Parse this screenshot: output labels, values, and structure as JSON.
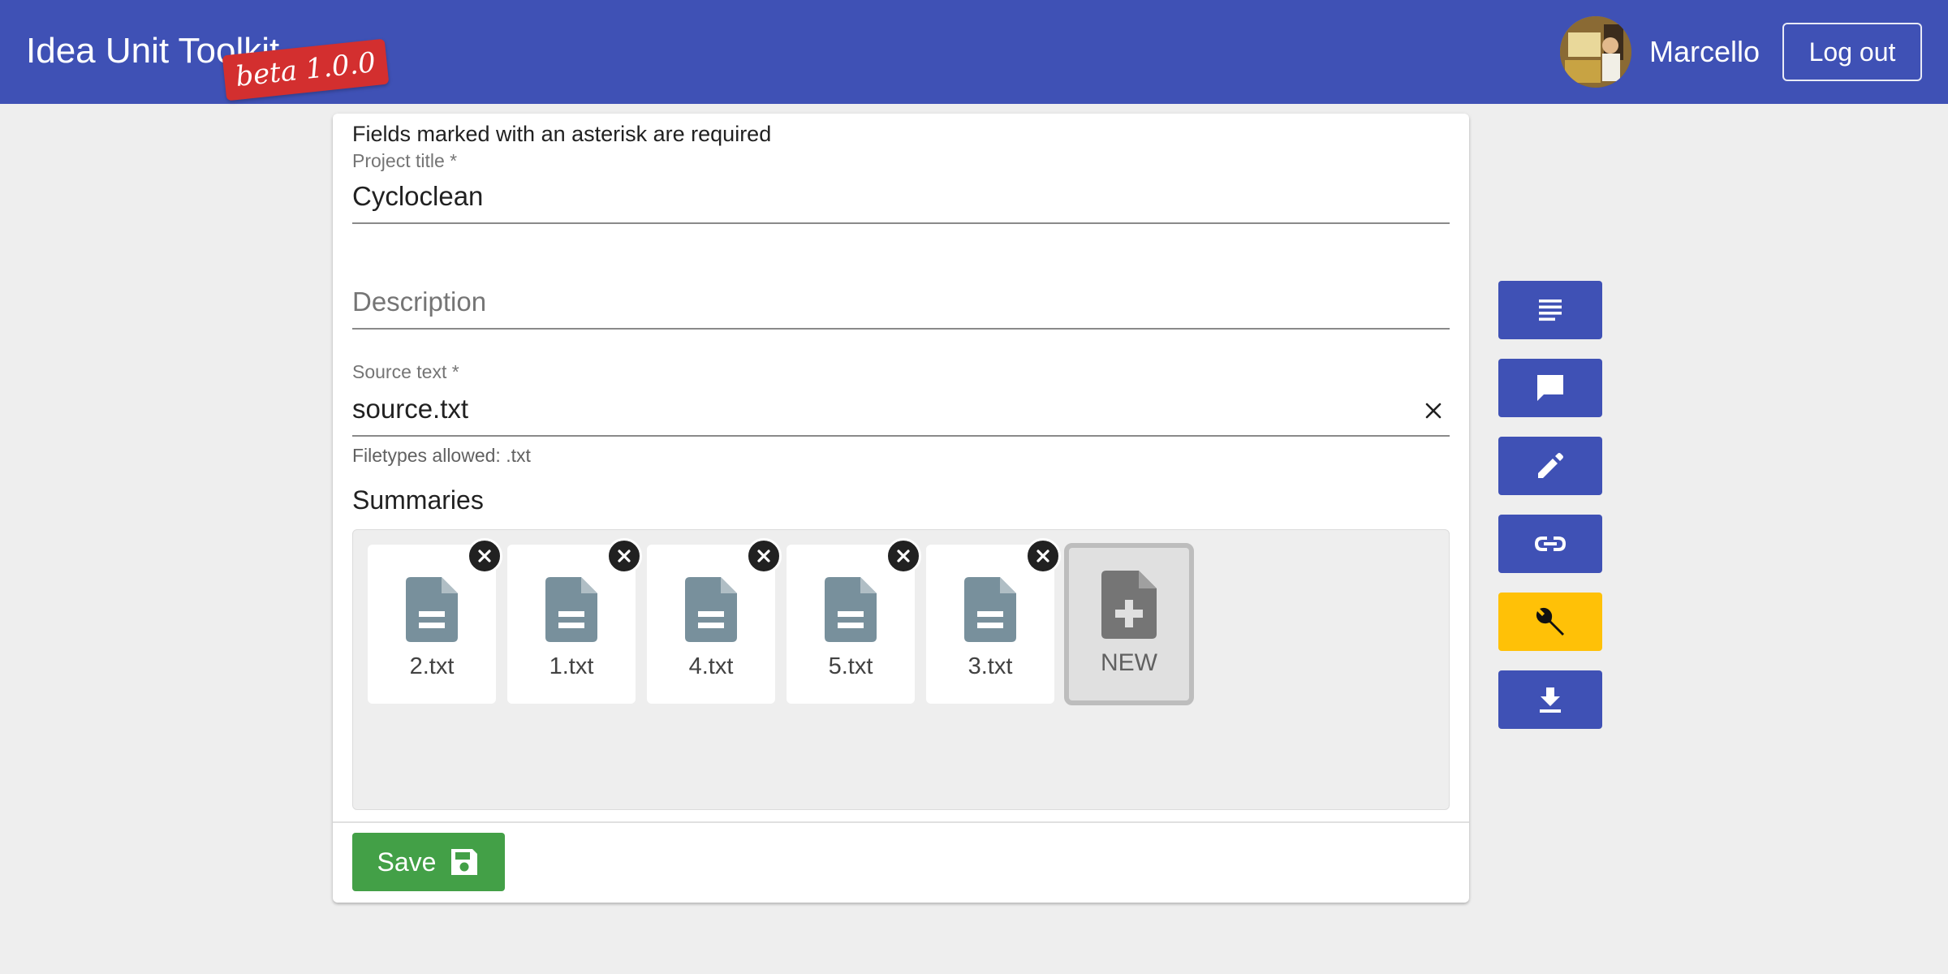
{
  "header": {
    "app_title": "Idea Unit Toolkit",
    "version_badge": "beta 1.0.0",
    "username": "Marcello",
    "logout_label": "Log out",
    "brand_color": "#3f51b5"
  },
  "form": {
    "required_note": "Fields marked with an asterisk are required",
    "project_title": {
      "label": "Project title *",
      "value": "Cycloclean"
    },
    "description": {
      "placeholder": "Description",
      "value": ""
    },
    "source_text": {
      "label": "Source text *",
      "value": "source.txt",
      "hint": "Filetypes allowed: .txt",
      "clear_icon": "close-icon"
    },
    "summaries": {
      "title": "Summaries",
      "files": [
        "2.txt",
        "1.txt",
        "4.txt",
        "5.txt",
        "3.txt"
      ],
      "new_label": "NEW"
    },
    "save_label": "Save",
    "save_color": "#43a047"
  },
  "sidebar_tools": [
    {
      "icon": "text-lines-icon",
      "active": false
    },
    {
      "icon": "comment-icon",
      "active": false
    },
    {
      "icon": "pencil-icon",
      "active": false
    },
    {
      "icon": "link-icon",
      "active": false
    },
    {
      "icon": "wrench-icon",
      "active": true
    },
    {
      "icon": "download-icon",
      "active": false
    }
  ],
  "colors": {
    "active_tool": "#ffc107",
    "tool": "#3f51b5"
  }
}
